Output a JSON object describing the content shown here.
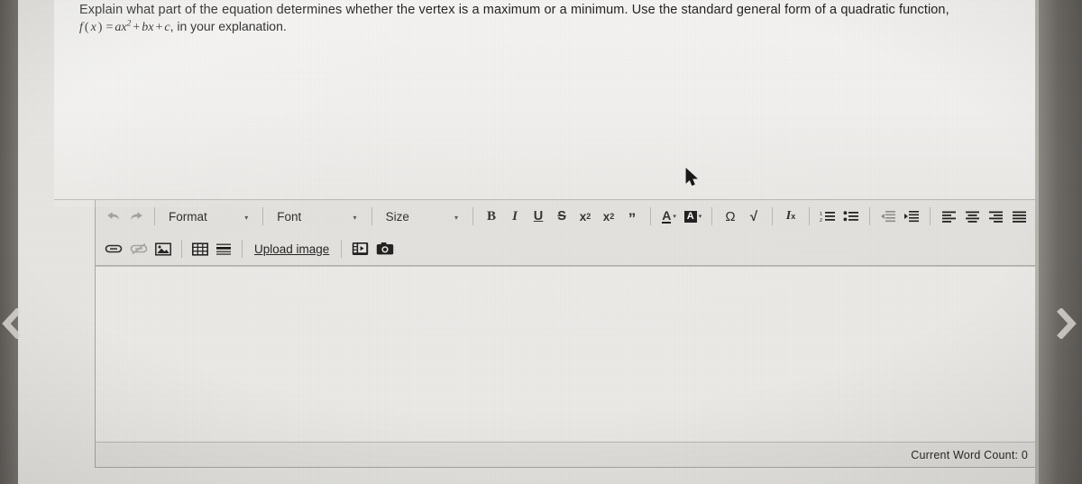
{
  "question": {
    "prompt": "Explain what part of the equation determines whether the vertex is a maximum or a minimum. Use the standard general form of a quadratic function,",
    "formula_text": "f(x) = ax² + bx + c, in your explanation.",
    "formula_parts": {
      "f": "f",
      "open": "(",
      "x1": "x",
      "close": ")",
      "equals": "=",
      "a": "a",
      "x2": "x",
      "exp": "2",
      "plus1": "+",
      "b": "b",
      "x3": "x",
      "plus2": "+",
      "c": "c",
      "tail": ", in your explanation."
    }
  },
  "editor": {
    "toolbar_row1": {
      "undo_label": "undo-arrow",
      "redo_label": "redo-arrow",
      "format": {
        "label": "Format",
        "caret": "▾"
      },
      "font": {
        "label": "Font",
        "caret": "▾"
      },
      "size": {
        "label": "Size",
        "caret": "▾"
      },
      "bold": "B",
      "italic": "I",
      "underline": "U",
      "strike": "S",
      "subscript_base": "x",
      "subscript_mark": "2",
      "superscript_base": "x",
      "superscript_mark": "2",
      "blockquote": "”",
      "text_color_glyph": "A",
      "text_color_caret": "▾",
      "bg_color_glyph": "A",
      "bg_color_caret": "▾",
      "special_char": "Ω",
      "spell_check": "√",
      "remove_format_base": "I",
      "remove_format_mark": "x"
    },
    "toolbar_row2": {
      "link": "link-icon",
      "unlink": "unlink-icon",
      "image": "image-icon",
      "table": "table-icon",
      "horizontal_rule": "horizontal-rule-icon",
      "upload_image_label": "Upload image",
      "video_label": "insert-video-icon",
      "camera_label": "webcam-capture-icon"
    },
    "list_buttons": {
      "numbered_list": "numbered-list-icon",
      "bulleted_list": "bulleted-list-icon",
      "outdent": "outdent-icon",
      "indent": "indent-icon",
      "align_left": "align-left-icon",
      "align_center": "align-center-icon",
      "align_right": "align-right-icon",
      "justify": "justify-icon"
    },
    "body_value": "",
    "body_placeholder": "",
    "status": {
      "word_count_label": "Current Word Count: 0"
    }
  },
  "navigation": {
    "previous_label": "‹",
    "next_label": "›"
  },
  "colors": {
    "page_bg": "#e9e7e3",
    "question_bg": "#f3f2f0",
    "toolbar_bg": "#e4e2de",
    "editor_body_bg": "#edebe8",
    "border": "#a9a7a2",
    "text": "#232323",
    "bezel": "#6f6c68"
  }
}
